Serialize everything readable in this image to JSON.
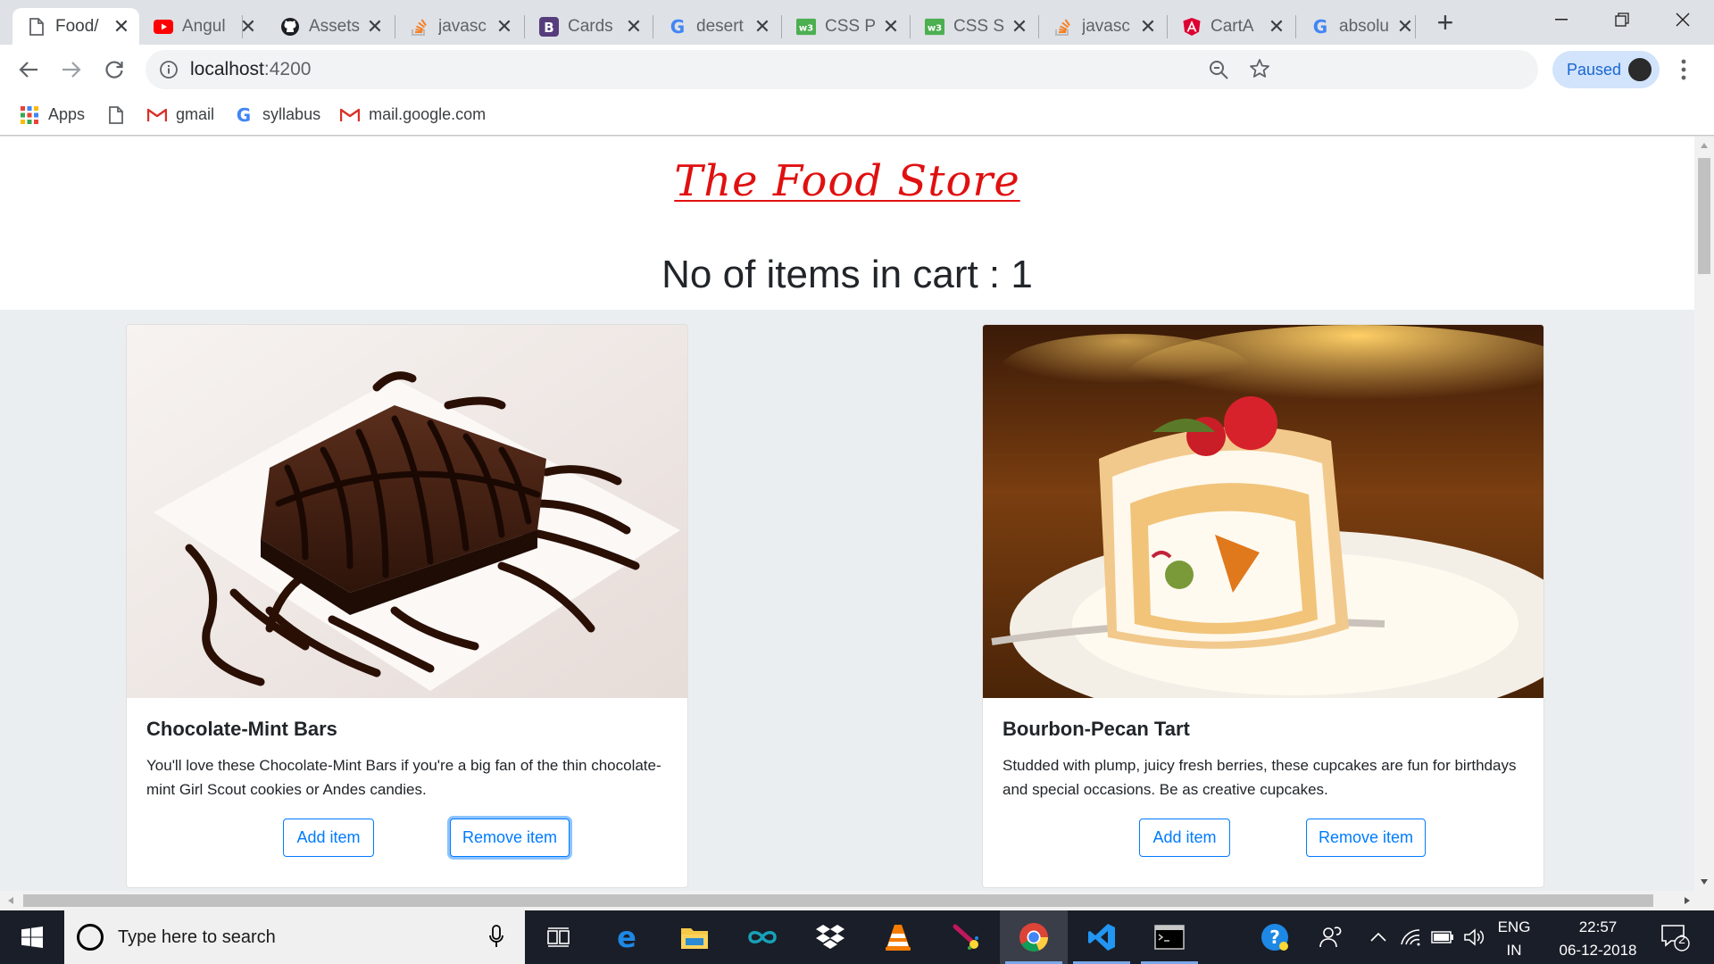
{
  "browser": {
    "tabs": [
      {
        "title": "Food/",
        "favicon": "page-icon",
        "active": true
      },
      {
        "title": "Angul",
        "favicon": "youtube-icon"
      },
      {
        "title": "Assets",
        "favicon": "github-icon"
      },
      {
        "title": "javasc",
        "favicon": "stackoverflow-icon"
      },
      {
        "title": "Cards",
        "favicon": "bootstrap-icon"
      },
      {
        "title": "desert",
        "favicon": "google-icon"
      },
      {
        "title": "CSS P",
        "favicon": "w3schools-icon"
      },
      {
        "title": "CSS S",
        "favicon": "w3schools-icon"
      },
      {
        "title": "javasc",
        "favicon": "stackoverflow-icon"
      },
      {
        "title": "CartA",
        "favicon": "angular-icon"
      },
      {
        "title": "absolu",
        "favicon": "google-icon"
      }
    ],
    "url_host": "localhost",
    "url_port": ":4200",
    "profile_status": "Paused",
    "bookmarks": [
      {
        "label": "Apps",
        "icon": "apps-grid-icon"
      },
      {
        "label": "",
        "icon": "page-icon"
      },
      {
        "label": "gmail",
        "icon": "gmail-icon"
      },
      {
        "label": "syllabus",
        "icon": "google-icon"
      },
      {
        "label": "mail.google.com",
        "icon": "gmail-icon"
      }
    ]
  },
  "page": {
    "title": "The Food Store",
    "cart_count_text": "No of items in cart : 1",
    "cards": [
      {
        "title": "Chocolate-Mint Bars",
        "text": "You'll love these Chocolate-Mint Bars if you're a big fan of the thin chocolate-mint Girl Scout cookies or Andes candies.",
        "add_label": "Add item",
        "remove_label": "Remove item",
        "image": "chocolate-brownie-image"
      },
      {
        "title": "Bourbon-Pecan Tart",
        "text": "Studded with plump, juicy fresh berries, these cupcakes are fun for birthdays and special occasions. Be as creative cupcakes.",
        "add_label": "Add item",
        "remove_label": "Remove item",
        "image": "swiss-roll-cake-image"
      }
    ]
  },
  "taskbar": {
    "search_placeholder": "Type here to search",
    "language": "ENG",
    "region": "IN",
    "time": "22:57",
    "date": "06-12-2018",
    "notification_count": "2"
  },
  "colors": {
    "title_red": "#e01010",
    "button_blue": "#007bff",
    "page_bg": "#ebeef0"
  }
}
